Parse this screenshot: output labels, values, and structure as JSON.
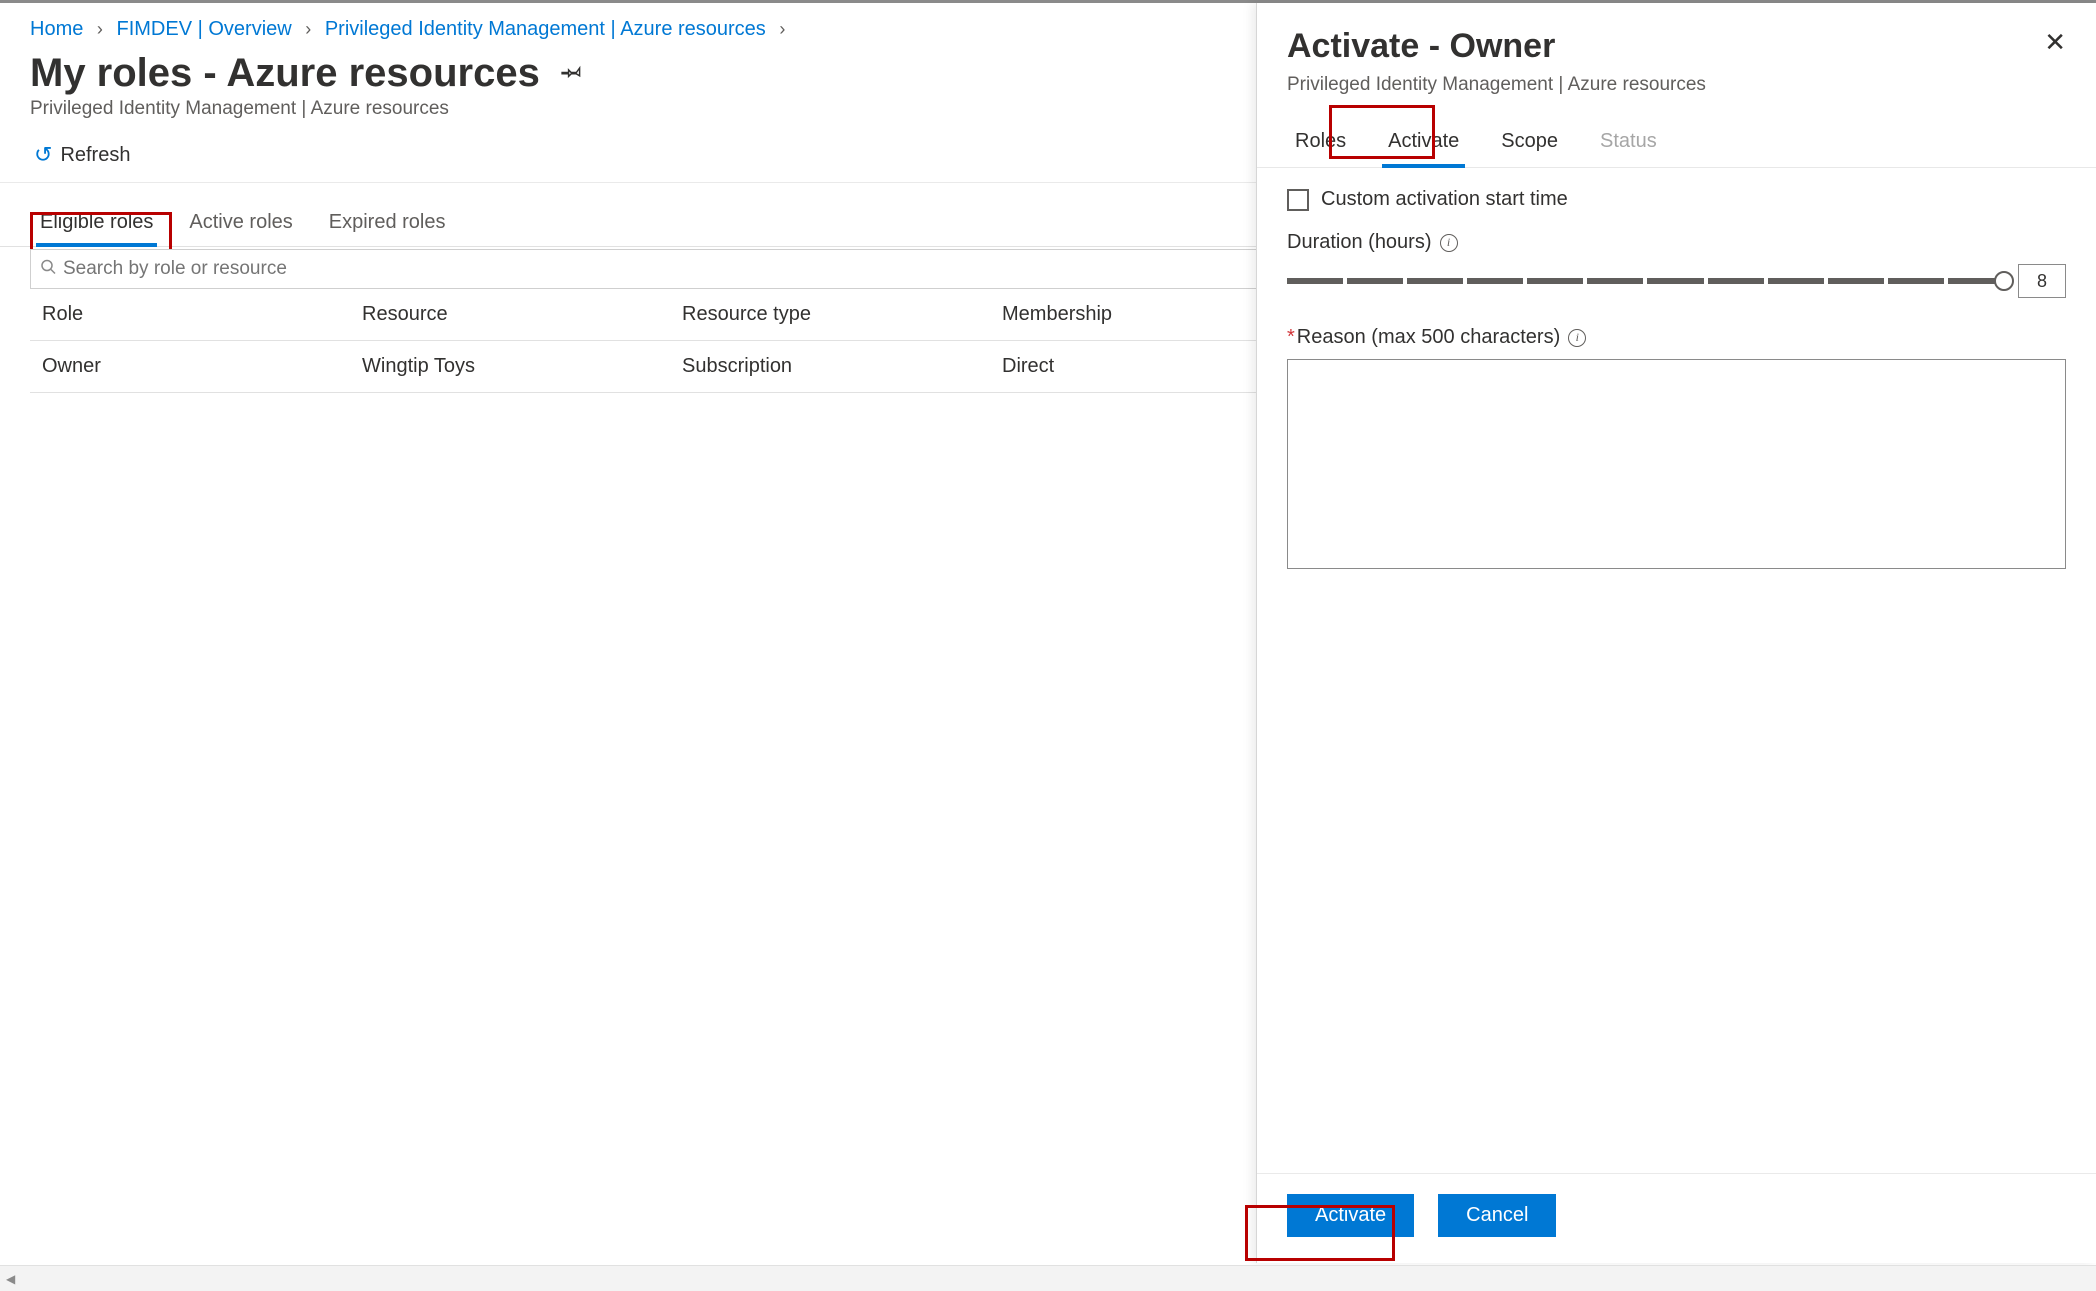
{
  "breadcrumb": {
    "home": "Home",
    "item1": "FIMDEV | Overview",
    "item2": "Privileged Identity Management | Azure resources"
  },
  "page": {
    "title": "My roles - Azure resources",
    "subtitle": "Privileged Identity Management | Azure resources"
  },
  "toolbar": {
    "refresh_label": "Refresh"
  },
  "tabs": {
    "eligible": "Eligible roles",
    "active": "Active roles",
    "expired": "Expired roles"
  },
  "search": {
    "placeholder": "Search by role or resource"
  },
  "table": {
    "headers": {
      "role": "Role",
      "resource": "Resource",
      "resource_type": "Resource type",
      "membership": "Membership"
    },
    "rows": [
      {
        "role": "Owner",
        "resource": "Wingtip Toys",
        "resource_type": "Subscription",
        "membership": "Direct"
      }
    ]
  },
  "panel": {
    "title": "Activate - Owner",
    "subtitle": "Privileged Identity Management | Azure resources",
    "tabs": {
      "roles": "Roles",
      "activate": "Activate",
      "scope": "Scope",
      "status": "Status"
    },
    "custom_start_label": "Custom activation start time",
    "duration_label": "Duration (hours)",
    "duration_value": "8",
    "reason_label": "Reason (max 500 characters)",
    "activate_label": "Activate",
    "cancel_label": "Cancel"
  }
}
